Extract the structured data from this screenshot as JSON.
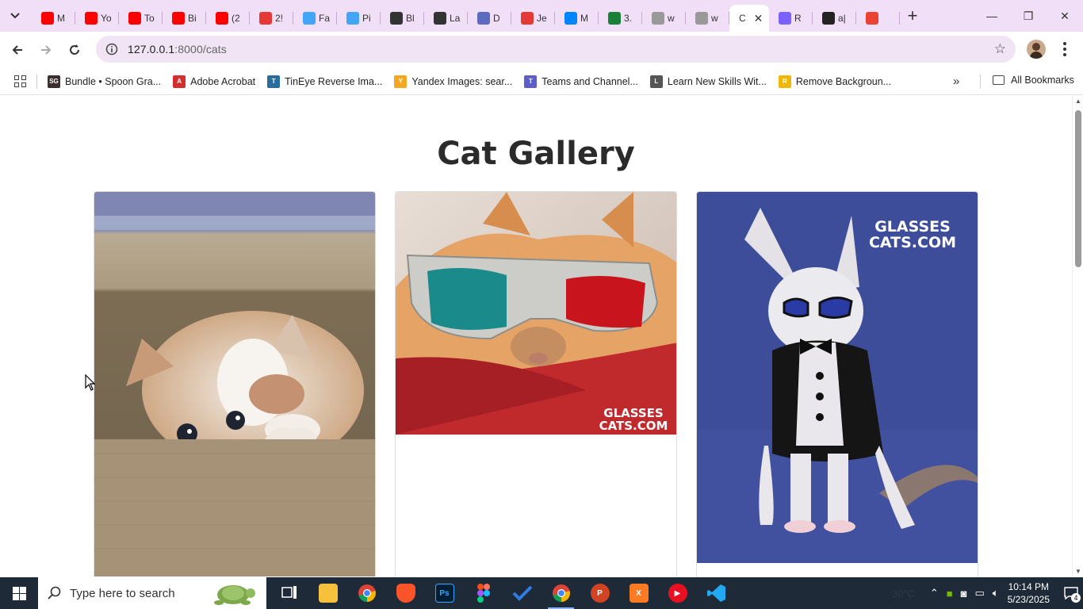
{
  "browser": {
    "tabs": [
      {
        "label": "M",
        "icon": "youtube-icon",
        "color": "#ff0000"
      },
      {
        "label": "Yo",
        "icon": "youtube-icon",
        "color": "#ff0000"
      },
      {
        "label": "To",
        "icon": "youtube-icon",
        "color": "#ff0000"
      },
      {
        "label": "Bi",
        "icon": "youtube-icon",
        "color": "#ff0000"
      },
      {
        "label": "(2",
        "icon": "youtube-icon",
        "color": "#ff0000"
      },
      {
        "label": "2!",
        "icon": "check-icon",
        "color": "#e53935"
      },
      {
        "label": "Fa",
        "icon": "flutter-icon",
        "color": "#42a5f5"
      },
      {
        "label": "Pi",
        "icon": "flutter-icon",
        "color": "#42a5f5"
      },
      {
        "label": "Bl",
        "icon": "openai-icon",
        "color": "#333333"
      },
      {
        "label": "La",
        "icon": "openai-icon",
        "color": "#333333"
      },
      {
        "label": "D",
        "icon": "app-icon",
        "color": "#5c6bc0"
      },
      {
        "label": "Je",
        "icon": "arc-icon",
        "color": "#e53935"
      },
      {
        "label": "M",
        "icon": "messenger-icon",
        "color": "#0084ff"
      },
      {
        "label": "3.",
        "icon": "sheets-icon",
        "color": "#188038"
      },
      {
        "label": "w",
        "icon": "github-icon",
        "color": "#999999"
      },
      {
        "label": "w",
        "icon": "github-icon",
        "color": "#999999"
      }
    ],
    "active_tab": {
      "label": "C",
      "close": "✕"
    },
    "tabs_after": [
      {
        "label": "R",
        "icon": "app-icon",
        "color": "#7b61ff"
      },
      {
        "label": "a|",
        "icon": "app-icon",
        "color": "#222222"
      },
      {
        "label": "",
        "icon": "gmail-icon",
        "color": "#ea4335"
      }
    ],
    "new_tab": "+",
    "window_controls": {
      "minimize": "—",
      "maximize": "❐",
      "close": "✕"
    },
    "address": {
      "host": "127.0.0.1",
      "path": ":8000/cats"
    },
    "bookmarks": [
      {
        "label": "Bundle • Spoon Gra...",
        "icon_text": "SG",
        "color": "#3b2f2f"
      },
      {
        "label": "Adobe Acrobat",
        "icon_text": "A",
        "color": "#d32f2f"
      },
      {
        "label": "TinEye Reverse Ima...",
        "icon_text": "T",
        "color": "#2b6c9e"
      },
      {
        "label": "Yandex Images: sear...",
        "icon_text": "Y",
        "color": "#f5a623"
      },
      {
        "label": "Teams and Channel...",
        "icon_text": "T",
        "color": "#5b5fc7"
      },
      {
        "label": "Learn New Skills Wit...",
        "icon_text": "L",
        "color": "#555555"
      },
      {
        "label": "Remove Backgroun...",
        "icon_text": "R",
        "color": "#f2b705"
      }
    ],
    "bookmarks_more": "»",
    "all_bookmarks": "All Bookmarks"
  },
  "page": {
    "title": "Cat Gallery",
    "cards": [
      {
        "name": "kitten-in-box"
      },
      {
        "name": "cat-3d-glasses",
        "watermark_line1": "GLASSES",
        "watermark_line2": "CATS.COM"
      },
      {
        "name": "cat-tuxedo-sunglasses",
        "watermark_line1": "GLASSES",
        "watermark_line2": "CATS.COM"
      }
    ]
  },
  "taskbar": {
    "search_placeholder": "Type here to search",
    "weather": "30°C",
    "time": "10:14 PM",
    "date": "5/23/2025",
    "notification_count": "4"
  }
}
